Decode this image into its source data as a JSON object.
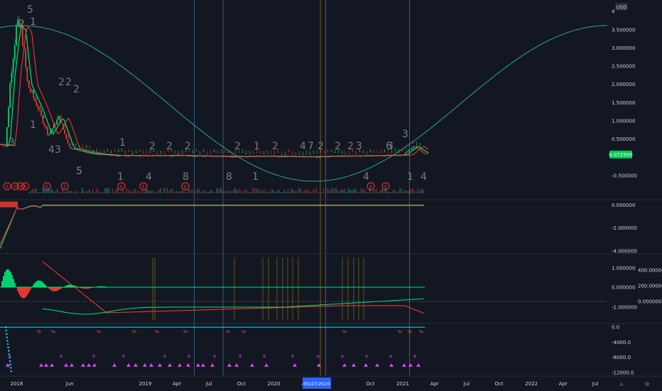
{
  "currency": "USD",
  "cursor_date": "05/27/2020",
  "corner_buttons": [
    "A",
    "⚙"
  ],
  "theme": {
    "background": "#131722",
    "up": "#26a69a",
    "bull": "#00e676",
    "bear": "#ff3b30",
    "blue_line": "#4a90c8",
    "orange_line": "#b8860b",
    "cycle": "#26a69a",
    "tag_bg": "#00c853",
    "magenta": "#e040fb",
    "cyan": "#00e5ff"
  },
  "chart_data": [
    {
      "type": "line",
      "panel": "price",
      "y_ticks": [
        "4",
        "3.500000",
        "3.000000",
        "2.500000",
        "2.000000",
        "1.500000",
        "1.000000",
        "0.500000",
        "-0.500000"
      ],
      "ylim": [
        -0.7,
        4.1
      ],
      "last_price_label": "0.072500",
      "last_price": 0.0725,
      "x_dates": [
        "2017-11-15",
        "2017-12-01",
        "2017-12-15",
        "2018-01-01",
        "2018-01-15",
        "2018-02-01",
        "2018-03-01",
        "2018-04-01",
        "2018-05-01",
        "2018-06-01",
        "2018-08-01",
        "2018-10-01",
        "2019-01-01",
        "2019-04-01",
        "2019-07-01",
        "2019-10-01",
        "2020-01-01",
        "2020-04-01",
        "2020-07-01",
        "2020-10-01",
        "2021-01-01",
        "2021-02-01",
        "2021-03-01",
        "2021-03-15"
      ],
      "series": [
        {
          "values": [
            0.35,
            0.3,
            2.2,
            3.6,
            3.5,
            2.0,
            1.4,
            0.6,
            1.1,
            0.25,
            0.1,
            0.05,
            0.04,
            0.05,
            0.03,
            0.02,
            0.03,
            0.01,
            0.03,
            0.04,
            0.06,
            0.3,
            0.12,
            0.07
          ]
        }
      ],
      "wave_counts": [
        "5",
        "2",
        "1",
        "3",
        "5",
        "2",
        "2",
        "2",
        "1",
        "4",
        "3",
        "5",
        "1",
        "2",
        "2",
        "2",
        "1",
        "4",
        "8",
        "2",
        "8",
        "1",
        "2",
        "1",
        "2",
        "4",
        "7",
        "2",
        "2",
        "3",
        "3",
        "6",
        "3",
        "4",
        "1",
        "4"
      ],
      "event_marker_label": "E",
      "event_marker_count": 11
    },
    {
      "type": "line",
      "panel": "oscillator",
      "y_ticks": [
        "0.000000",
        "-2.000000",
        "-4.000000"
      ],
      "ylim": [
        -4.2,
        0.4
      ]
    },
    {
      "type": "bar",
      "panel": "macd",
      "y_ticks_left": [
        "1.000000",
        "0.000000",
        "-1.000000"
      ],
      "y_ticks_right": [
        "400.000000",
        "200.000000",
        "0.000000"
      ]
    },
    {
      "type": "scatter",
      "panel": "volume_osc",
      "y_ticks": [
        "0.0",
        "-4000.0",
        "-8000.0",
        "-12000.0"
      ],
      "ylim": [
        -12800,
        800
      ],
      "marker_label": "9",
      "tag_label": "9p"
    }
  ],
  "x_axis": {
    "labels": [
      "2018",
      "Jun",
      "2019",
      "Apr",
      "Jul",
      "Oct",
      "2020",
      "Apr",
      "Oct",
      "2021",
      "Apr",
      "Jul",
      "Oct",
      "2022",
      "Apr",
      "Jul"
    ]
  }
}
